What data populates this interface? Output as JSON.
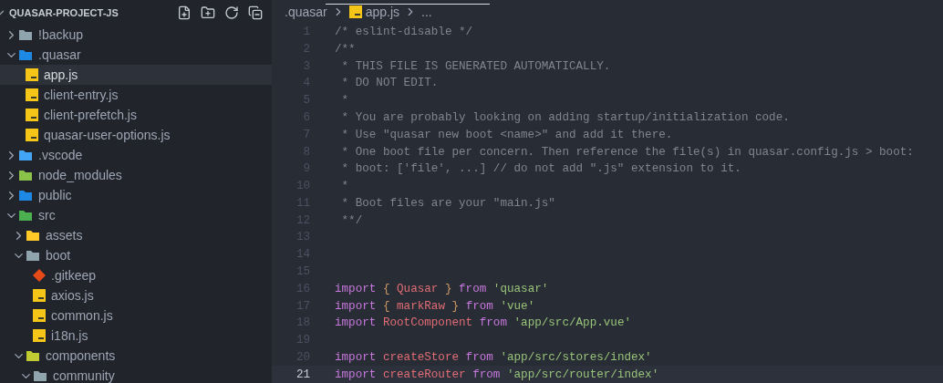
{
  "explorer": {
    "title": "QUASAR-PROJECT-JS",
    "expanded": true,
    "tree": [
      {
        "label": "!backup",
        "kind": "folder",
        "color": "#90a4ae",
        "expanded": false,
        "selected": false
      },
      {
        "label": ".quasar",
        "kind": "folder",
        "color": "#1e88e5",
        "expanded": true,
        "selected": false,
        "children": [
          {
            "label": "app.js",
            "kind": "js",
            "selected": true
          },
          {
            "label": "client-entry.js",
            "kind": "js",
            "selected": false
          },
          {
            "label": "client-prefetch.js",
            "kind": "js",
            "selected": false
          },
          {
            "label": "quasar-user-options.js",
            "kind": "js",
            "selected": false
          }
        ]
      },
      {
        "label": ".vscode",
        "kind": "folder",
        "color": "#42a5f5",
        "expanded": false,
        "selected": false
      },
      {
        "label": "node_modules",
        "kind": "folder",
        "color": "#8bc34a",
        "expanded": false,
        "selected": false
      },
      {
        "label": "public",
        "kind": "folder",
        "color": "#1e88e5",
        "expanded": false,
        "selected": false
      },
      {
        "label": "src",
        "kind": "folder",
        "color": "#4caf50",
        "expanded": true,
        "selected": false,
        "children": [
          {
            "label": "assets",
            "kind": "folder",
            "color": "#ffca28",
            "expanded": false,
            "selected": false
          },
          {
            "label": "boot",
            "kind": "folder",
            "color": "#90a4ae",
            "expanded": true,
            "selected": false,
            "children": [
              {
                "label": ".gitkeep",
                "kind": "git",
                "selected": false
              },
              {
                "label": "axios.js",
                "kind": "js",
                "selected": false
              },
              {
                "label": "common.js",
                "kind": "js",
                "selected": false
              },
              {
                "label": "i18n.js",
                "kind": "js",
                "selected": false
              }
            ]
          },
          {
            "label": "components",
            "kind": "folder",
            "color": "#c0ca33",
            "expanded": true,
            "selected": false,
            "children": [
              {
                "label": "community",
                "kind": "folder",
                "color": "#90a4ae",
                "expanded": true,
                "selected": false
              }
            ]
          }
        ]
      }
    ]
  },
  "breadcrumb": [
    {
      "label": ".quasar",
      "kind": "folder"
    },
    {
      "label": "app.js",
      "kind": "js"
    },
    {
      "label": "...",
      "kind": "more"
    }
  ],
  "editor": {
    "lines": [
      {
        "number": "1",
        "current": false,
        "tokens": [
          {
            "kind": "comment",
            "text": "/* eslint-disable */"
          }
        ]
      },
      {
        "number": "2",
        "current": false,
        "tokens": [
          {
            "kind": "comment",
            "text": "/**"
          }
        ]
      },
      {
        "number": "3",
        "current": false,
        "tokens": [
          {
            "kind": "comment",
            "text": " * THIS FILE IS GENERATED AUTOMATICALLY."
          }
        ]
      },
      {
        "number": "4",
        "current": false,
        "tokens": [
          {
            "kind": "comment",
            "text": " * DO NOT EDIT."
          }
        ]
      },
      {
        "number": "5",
        "current": false,
        "tokens": [
          {
            "kind": "comment",
            "text": " *"
          }
        ]
      },
      {
        "number": "6",
        "current": false,
        "tokens": [
          {
            "kind": "comment",
            "text": " * You are probably looking on adding startup/initialization code."
          }
        ]
      },
      {
        "number": "7",
        "current": false,
        "tokens": [
          {
            "kind": "comment",
            "text": " * Use \"quasar new boot <name>\" and add it there."
          }
        ]
      },
      {
        "number": "8",
        "current": false,
        "tokens": [
          {
            "kind": "comment",
            "text": " * One boot file per concern. Then reference the file(s) in quasar.config.js > boot:"
          }
        ]
      },
      {
        "number": "9",
        "current": false,
        "tokens": [
          {
            "kind": "comment",
            "text": " * boot: ['file', ...] // do not add \".js\" extension to it."
          }
        ]
      },
      {
        "number": "10",
        "current": false,
        "tokens": [
          {
            "kind": "comment",
            "text": " *"
          }
        ]
      },
      {
        "number": "11",
        "current": false,
        "tokens": [
          {
            "kind": "comment",
            "text": " * Boot files are your \"main.js\""
          }
        ]
      },
      {
        "number": "12",
        "current": false,
        "tokens": [
          {
            "kind": "comment",
            "text": " **/"
          }
        ]
      },
      {
        "number": "13",
        "current": false
      },
      {
        "number": "14",
        "current": false
      },
      {
        "number": "15",
        "current": false
      },
      {
        "number": "16",
        "current": false,
        "tokens": [
          {
            "kind": "keyword",
            "text": "import "
          },
          {
            "kind": "brace",
            "text": "{ "
          },
          {
            "kind": "variable",
            "text": "Quasar "
          },
          {
            "kind": "brace",
            "text": "} "
          },
          {
            "kind": "keyword",
            "text": "from "
          },
          {
            "kind": "string",
            "text": "'quasar'"
          }
        ]
      },
      {
        "number": "17",
        "current": false,
        "tokens": [
          {
            "kind": "keyword",
            "text": "import "
          },
          {
            "kind": "brace",
            "text": "{ "
          },
          {
            "kind": "variable",
            "text": "markRaw "
          },
          {
            "kind": "brace",
            "text": "} "
          },
          {
            "kind": "keyword",
            "text": "from "
          },
          {
            "kind": "string",
            "text": "'vue'"
          }
        ]
      },
      {
        "number": "18",
        "current": false,
        "tokens": [
          {
            "kind": "keyword",
            "text": "import "
          },
          {
            "kind": "variable",
            "text": "RootComponent "
          },
          {
            "kind": "keyword",
            "text": "from "
          },
          {
            "kind": "string",
            "text": "'app/src/App.vue'"
          }
        ]
      },
      {
        "number": "19",
        "current": false
      },
      {
        "number": "20",
        "current": false,
        "tokens": [
          {
            "kind": "keyword",
            "text": "import "
          },
          {
            "kind": "variable",
            "text": "createStore "
          },
          {
            "kind": "keyword",
            "text": "from "
          },
          {
            "kind": "string",
            "text": "'app/src/stores/index'"
          }
        ]
      },
      {
        "number": "21",
        "current": true,
        "tokens": [
          {
            "kind": "keyword",
            "text": "import "
          },
          {
            "kind": "variable",
            "text": "createRouter "
          },
          {
            "kind": "keyword",
            "text": "from "
          },
          {
            "kind": "string",
            "text": "'app/src/router/index'"
          }
        ]
      }
    ]
  }
}
